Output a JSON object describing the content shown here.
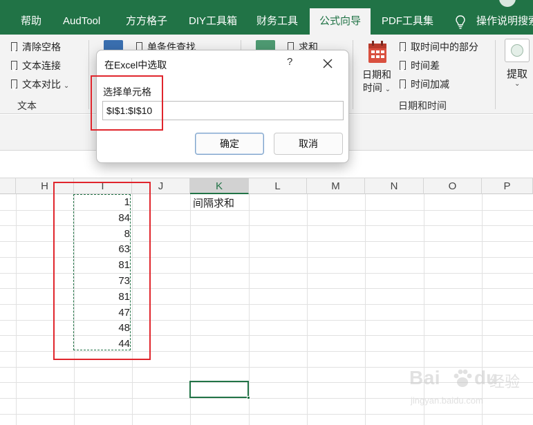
{
  "ribbon_tabs": [
    {
      "label": "帮助",
      "active": false
    },
    {
      "label": "AudTool",
      "active": false
    },
    {
      "label": "方方格子",
      "active": false
    },
    {
      "label": "DIY工具箱",
      "active": false
    },
    {
      "label": "财务工具",
      "active": false
    },
    {
      "label": "公式向导",
      "active": true
    },
    {
      "label": "PDF工具集",
      "active": false
    },
    {
      "label": "操作说明搜索",
      "active": false
    }
  ],
  "ribbon": {
    "text_group": {
      "items": [
        "清除空格",
        "文本连接",
        "文本对比"
      ],
      "label": "文本"
    },
    "lookup_item": "单条件查找",
    "sum_item": "求和",
    "datetime_group": {
      "big_button_line1": "日期和",
      "big_button_line2": "时间",
      "items": [
        "取时间中的部分",
        "时间差",
        "时间加减"
      ],
      "label": "日期和时间"
    },
    "extract_button": "提取"
  },
  "dialog": {
    "title": "在Excel中选取",
    "help": "?",
    "field_label": "选择单元格",
    "field_value": "$I$1:$I$10",
    "ok_label": "确定",
    "cancel_label": "取消"
  },
  "sheet": {
    "columns": [
      "H",
      "I",
      "J",
      "K",
      "L",
      "M",
      "N",
      "O",
      "P"
    ],
    "selected_column": "K",
    "column_i_values": [
      "1",
      "84",
      "8",
      "63",
      "81",
      "73",
      "81",
      "47",
      "48",
      "44"
    ],
    "k1_text": "间隔求和"
  },
  "watermark": {
    "brand": "Bai",
    "brand2": "经验",
    "url": "jingyan.baidu.com"
  },
  "colors": {
    "excel_green": "#217346",
    "annotation_red": "#e0252c"
  }
}
